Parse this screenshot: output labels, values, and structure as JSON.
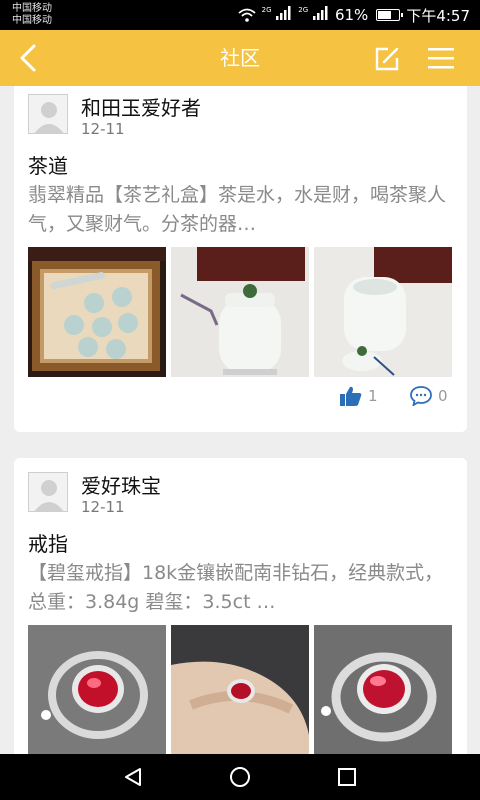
{
  "status_bar": {
    "carrier_1": "中国移动",
    "carrier_2": "中国移动",
    "net_1": "2G",
    "net_2": "2G",
    "battery_pct": "61%",
    "battery_level": 0.61,
    "time": "下午4:57"
  },
  "header": {
    "title": "社区",
    "back_icon": "chevron-left-icon",
    "edit_icon": "edit-icon",
    "menu_icon": "menu-icon"
  },
  "posts": [
    {
      "author": "和田玉爱好者",
      "date": "12-11",
      "title": "茶道",
      "excerpt": "翡翠精品【茶艺礼盒】茶是水，水是财，喝茶聚人气，又聚财气。分茶的器…",
      "images": [
        "tea-set-box-image",
        "jade-tea-caddy-image",
        "jade-cup-image"
      ],
      "likes": "1",
      "comments": "0"
    },
    {
      "author": "爱好珠宝",
      "date": "12-11",
      "title": "戒指",
      "excerpt": "【碧玺戒指】18k金镶嵌配南非钻石，经典款式，总重：3.84g 碧玺：3.5ct …",
      "images": [
        "tourmaline-ring-image",
        "ring-on-hand-image",
        "ring-closeup-image"
      ]
    }
  ],
  "nav_bar": {
    "back_icon": "triangle-back-icon",
    "home_icon": "circle-home-icon",
    "recent_icon": "square-recent-icon"
  },
  "colors": {
    "accent": "#f6c242",
    "like_blue": "#2d6fb7",
    "text_gray": "#8a8a8a"
  }
}
